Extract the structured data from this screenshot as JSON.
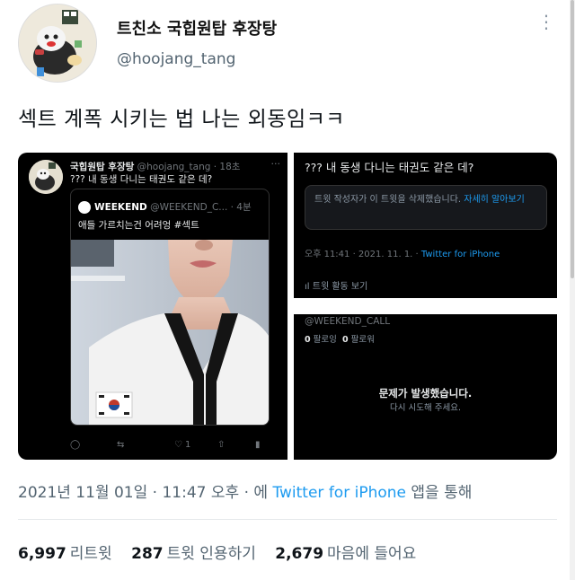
{
  "tweet": {
    "author": {
      "display_name": "트친소 국힙원탑 후장탕",
      "handle": "@hoojang_tang",
      "avatar_icon": "cartoon-avatar"
    },
    "more_icon": "more-vertical-icon",
    "text": "섹트 계폭 시키는 법 나는 외동임ㅋㅋ",
    "meta": {
      "date": "2021년 11월 01일",
      "sep1": " · ",
      "time": "11:47 오후",
      "sep2": " · 에 ",
      "via": "Twitter for iPhone",
      "suffix": " 앱을 통해"
    },
    "stats": {
      "retweets": "6,997",
      "retweets_label": "리트윗",
      "quotes": "287",
      "quotes_label": "트윗 인용하기",
      "likes": "2,679",
      "likes_label": "마음에 들어요"
    }
  },
  "media": {
    "left": {
      "name": "국힙원탑 후장탕",
      "meta": " @hoojang_tang · 18초",
      "dots": "···",
      "text": "??? 내 동생 다니는 태권도 같은 데?",
      "quote": {
        "name": "WEEKEND",
        "meta": " @WEEKEND_C... · 4분",
        "text": "애들 가르치는건 어려엉 #섹트"
      },
      "actions": {
        "reply_icon": "reply-icon",
        "retweet_icon": "retweet-icon",
        "like_icon": "heart-icon",
        "like_count": "1",
        "share_icon": "share-icon",
        "stats_icon": "analytics-icon"
      }
    },
    "right_top": {
      "text": "??? 내 동생 다니는 태권도 같은 데?",
      "deleted_notice": "트윗 작성자가 이 트윗을 삭제했습니다. ",
      "learn_more": "자세히 알아보기",
      "time": "오후 11:41 · 2021. 11. 1. · ",
      "via": "Twitter for iPhone",
      "activity": "트윗 활동 보기"
    },
    "right_bottom": {
      "handle": "@WEEKEND_CALL",
      "following_count": "0",
      "following_label": "팔로잉",
      "followers_count": "0",
      "followers_label": "팔로워",
      "error_title": "문제가 발생했습니다.",
      "error_retry": "다시 시도해 주세요."
    }
  }
}
